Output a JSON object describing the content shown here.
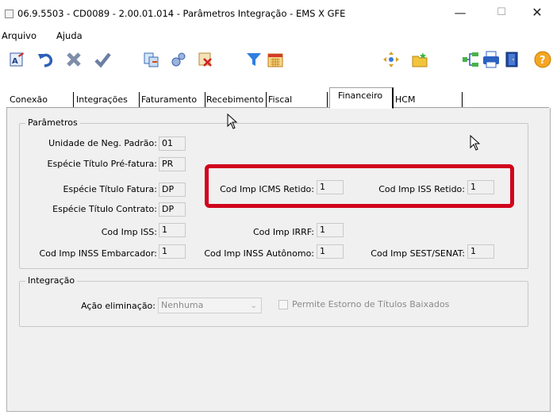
{
  "window": {
    "title": "06.9.5503 - CD0089 - 2.00.01.014 - Parâmetros Integração - EMS X GFE",
    "minimize": "—",
    "maximize": "☐",
    "close": "✕"
  },
  "menu": {
    "items": [
      "Arquivo",
      "Ajuda"
    ]
  },
  "toolbar": {
    "icons": [
      "document-edit-icon",
      "undo-icon",
      "delete-icon",
      "confirm-icon",
      "transfer-icon",
      "settings-icon",
      "cancel-doc-icon",
      "filter-icon",
      "calendar-icon",
      "move-icon",
      "new-folder-icon",
      "tree-icon",
      "print-icon",
      "exit-icon",
      "help-icon"
    ]
  },
  "tabs": [
    "Conexão",
    "Integrações",
    "Faturamento",
    "Recebimento",
    "Fiscal",
    "Financeiro",
    "HCM"
  ],
  "active_tab": "Financeiro",
  "parametros": {
    "legend": "Parâmetros",
    "unidade_label": "Unidade de Neg. Padrão:",
    "unidade_value": "01",
    "especie_pre_label": "Espécie Título Pré-fatura:",
    "especie_pre_value": "PR",
    "especie_fatura_label": "Espécie Título Fatura:",
    "especie_fatura_value": "DP",
    "especie_contrato_label": "Espécie Título Contrato:",
    "especie_contrato_value": "DP",
    "icms_label": "Cod Imp ICMS Retido:",
    "icms_value": "1",
    "iss_retido_label": "Cod Imp ISS Retido:",
    "iss_retido_value": "1",
    "iss_label": "Cod Imp ISS:",
    "iss_value": "1",
    "irrf_label": "Cod Imp IRRF:",
    "irrf_value": "1",
    "inss_emb_label": "Cod Imp INSS Embarcador:",
    "inss_emb_value": "1",
    "inss_aut_label": "Cod Imp INSS Autônomo:",
    "inss_aut_value": "1",
    "sest_label": "Cod Imp SEST/SENAT:",
    "sest_value": "1"
  },
  "integracao": {
    "legend": "Integração",
    "acao_label": "Ação eliminação:",
    "acao_value": "Nenhuma",
    "estorno_label": "Permite Estorno de Títulos Baixados"
  },
  "colors": {
    "highlight": "#d0021b",
    "panel_bg": "#f0f0f0"
  }
}
